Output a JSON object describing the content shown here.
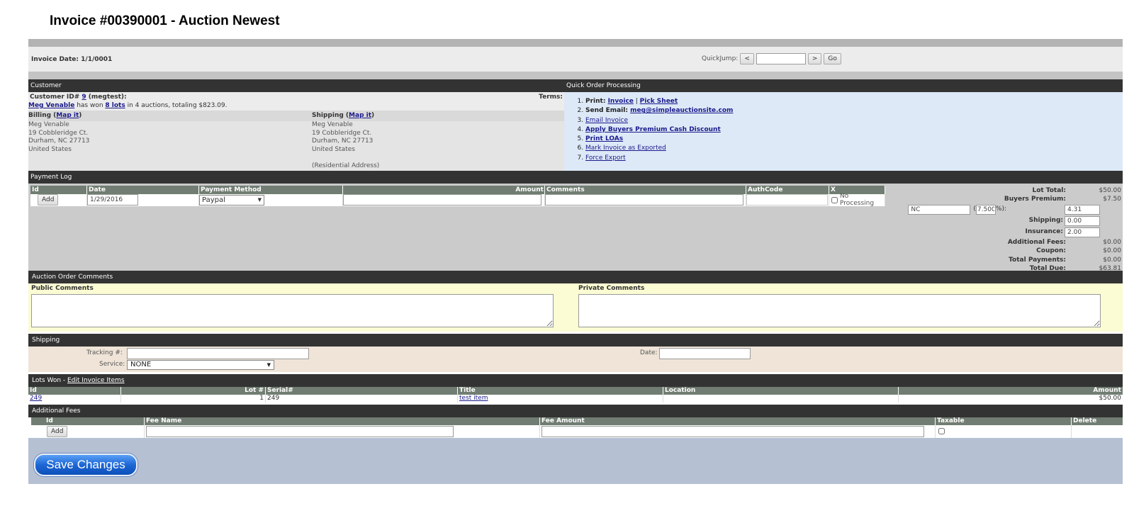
{
  "page": {
    "title": "Invoice #00390001 - Auction Newest"
  },
  "invoice_bar": {
    "date_label": "Invoice Date: 1/1/0001",
    "quickjump_label": "QuickJump:",
    "prev": "<",
    "next": ">",
    "go": "Go"
  },
  "customer": {
    "header": "Customer",
    "id_label_pre": "Customer ID# ",
    "id": "9",
    "id_label_post": " (megtest):",
    "terms_label": "Terms:",
    "name_link": "Meg Venable",
    "won_text_1": " has won ",
    "lots_link": "8 lots",
    "won_text_2": " in 4 auctions, totaling $823.09.",
    "billing": {
      "label": "Billing (",
      "map": "Map it",
      "close": ")",
      "lines": [
        "Meg Venable",
        "19 Cobbleridge Ct.",
        "Durham, NC 27713",
        "United States"
      ]
    },
    "shipping": {
      "label": "Shipping (",
      "map": "Map it",
      "close": ")",
      "lines": [
        "Meg Venable",
        "19 Cobbleridge Ct.",
        "Durham, NC 27713",
        "United States"
      ],
      "note": "(Residential Address)"
    }
  },
  "quick_order": {
    "header": "Quick Order Processing",
    "print_label": "Print: ",
    "print_invoice": "Invoice",
    "sep": " | ",
    "print_pick": "Pick Sheet",
    "send_label": "Send Email: ",
    "email": "meg@simpleauctionsite.com",
    "email_invoice": "Email Invoice",
    "apply_bp": "Apply Buyers Premium Cash Discount",
    "print_loas": "Print LOAs",
    "mark_exported": "Mark Invoice as Exported",
    "force_export": "Force Export"
  },
  "payment_log": {
    "header": "Payment Log",
    "columns": [
      "Id",
      "Date",
      "Payment Method",
      "Amount",
      "Comments",
      "AuthCode",
      "X"
    ],
    "add": "Add",
    "date_value": "1/29/2016",
    "method_value": "Paypal",
    "no_processing": "No Processing"
  },
  "totals": {
    "lot_total_label": "Lot Total:",
    "lot_total": "$50.00",
    "bp_label": "Buyers Premium:",
    "bp": "$7.50",
    "state": "NC",
    "rate_open": "(",
    "rate": "7.500",
    "rate_close": "%):",
    "tax": "4.31",
    "shipping_label": "Shipping:",
    "shipping": "0.00",
    "insurance_label": "Insurance:",
    "insurance": "2.00",
    "fees_label": "Additional Fees:",
    "fees": "$0.00",
    "coupon_label": "Coupon:",
    "coupon": "$0.00",
    "payments_label": "Total Payments:",
    "payments": "$0.00",
    "due_label": "Total Due:",
    "due": "$63.81"
  },
  "comments": {
    "header": "Auction Order Comments",
    "public": "Public Comments",
    "private": "Private Comments"
  },
  "shipping_section": {
    "header": "Shipping",
    "tracking_label": "Tracking #:",
    "date_label": "Date:",
    "service_label": "Service:",
    "service_value": "NONE"
  },
  "lots": {
    "header_pre": "Lots Won - ",
    "edit_link": "Edit Invoice Items",
    "columns": [
      "Id",
      "Lot #",
      "Serial#",
      "Title",
      "Location",
      "Amount"
    ],
    "rows": [
      {
        "id": "249",
        "lot": "1",
        "serial": "249",
        "title": "test item",
        "location": "",
        "amount": "$50.00"
      }
    ]
  },
  "fees": {
    "header": "Additional Fees",
    "columns": [
      "Id",
      "Fee Name",
      "Fee Amount",
      "Taxable",
      "Delete"
    ],
    "add": "Add"
  },
  "save": {
    "label": "Save Changes"
  }
}
